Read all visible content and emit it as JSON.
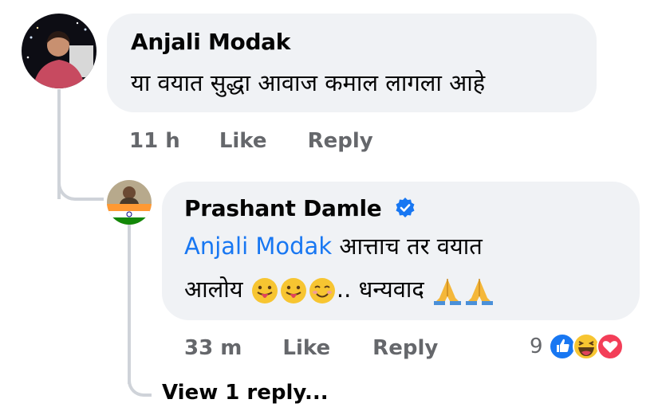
{
  "comment": {
    "author": "Anjali Modak",
    "text": "या वयात सुद्धा  आवाज कमाल लागला आहे",
    "time": "11 h",
    "like_label": "Like",
    "reply_label": "Reply"
  },
  "reply": {
    "author": "Prashant Damle",
    "verified": true,
    "mention": "Anjali Modak",
    "text_line1": " आत्ताच तर वयात",
    "text_line2_start": "आलोय ",
    "text_line2_mid": ".. धन्यवाद ",
    "time": "33 m",
    "like_label": "Like",
    "reply_label": "Reply",
    "reaction_count": "9",
    "reactions": [
      "like-icon",
      "haha-icon",
      "love-icon"
    ]
  },
  "view_replies": "View 1 reply...",
  "colors": {
    "bubble": "#f0f2f5",
    "link": "#1877f2",
    "meta": "#65676b",
    "thread_line": "#cfd3d9"
  }
}
